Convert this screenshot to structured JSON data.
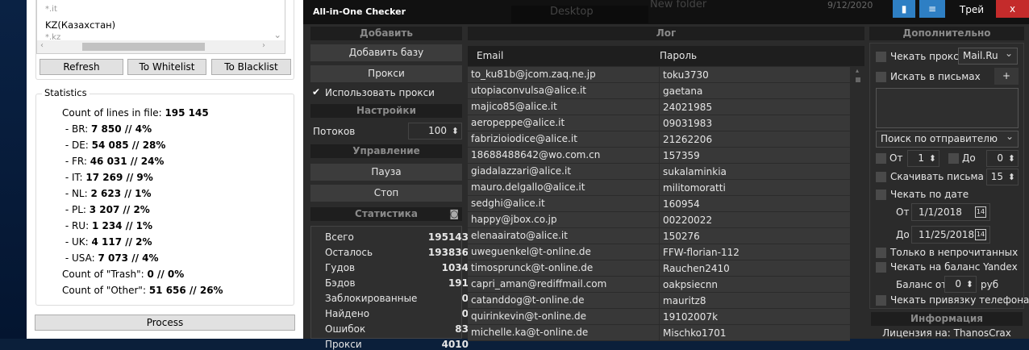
{
  "left_window": {
    "list_items": [
      "*.it",
      "KZ(Казахстан)",
      "*.kz"
    ],
    "buttons": {
      "refresh": "Refresh",
      "whitelist": "To Whitelist",
      "blacklist": "To Blacklist"
    },
    "statistics": {
      "title": "Statistics",
      "lines": [
        {
          "label": "Count of lines in file: ",
          "value": "195 145"
        },
        {
          "label": " - BR: ",
          "value": "7 850 // 4%"
        },
        {
          "label": " - DE: ",
          "value": "54 085 // 28%"
        },
        {
          "label": " - FR: ",
          "value": "46 031 // 24%"
        },
        {
          "label": " - IT: ",
          "value": "17 269 // 9%"
        },
        {
          "label": " - NL: ",
          "value": "2 623 // 1%"
        },
        {
          "label": " - PL: ",
          "value": "3 207 // 2%"
        },
        {
          "label": " - RU: ",
          "value": "1 234 // 1%"
        },
        {
          "label": " - UK: ",
          "value": "4 117 // 2%"
        },
        {
          "label": " - USA: ",
          "value": "7 073 // 4%"
        },
        {
          "label": "Count of \"Trash\": ",
          "value": "0 // 0%"
        },
        {
          "label": "Count of \"Other\": ",
          "value": "51 656 // 26%"
        }
      ]
    },
    "process": "Process"
  },
  "background": {
    "desktop": "Desktop",
    "folder": "New folder",
    "date": "9/12/2020"
  },
  "app": {
    "title": "All-in-One Checker",
    "tray": "Трей",
    "close": "x",
    "left": {
      "add_header": "Добавить",
      "add_base": "Добавить базу",
      "proxy": "Прокси",
      "use_proxy": "Использовать прокси",
      "use_proxy_checked": true,
      "settings_header": "Настройки",
      "threads_label": "Потоков",
      "threads": "100",
      "control_header": "Управление",
      "pause": "Пауза",
      "stop": "Стоп",
      "stats_header": "Статистика",
      "stats": [
        {
          "label": "Всего",
          "value": "195143"
        },
        {
          "label": "Осталось",
          "value": "193836"
        },
        {
          "label": "Гудов",
          "value": "1034"
        },
        {
          "label": "Бэдов",
          "value": "191"
        },
        {
          "label": "Заблокированные",
          "value": "0"
        },
        {
          "label": "Найдено",
          "value": "0"
        },
        {
          "label": "Ошибок",
          "value": "83"
        },
        {
          "label": "Прокси",
          "value": "4010"
        }
      ]
    },
    "log": {
      "header": "Лог",
      "columns": [
        "Email",
        "Пароль"
      ],
      "rows": [
        [
          "to_ku81b@jcom.zaq.ne.jp",
          "toku3730"
        ],
        [
          "utopiaconvulsa@alice.it",
          "gaetana"
        ],
        [
          "majico85@alice.it",
          "24021985"
        ],
        [
          "aeropeppe@alice.it",
          "09031983"
        ],
        [
          "fabrizioiodice@alice.it",
          "21262206"
        ],
        [
          "18688488642@wo.com.cn",
          "157359"
        ],
        [
          "giadalazzari@alice.it",
          "sukalaminkia"
        ],
        [
          "mauro.delgallo@alice.it",
          "militomoratti"
        ],
        [
          "sedghi@alice.it",
          "160954"
        ],
        [
          "happy@jbox.co.jp",
          "00220022"
        ],
        [
          "elenaairato@alice.it",
          "150276"
        ],
        [
          "uweguenkel@t-online.de",
          "FFW-florian-112"
        ],
        [
          "timosprunck@t-online.de",
          "Rauchen2410"
        ],
        [
          "capri_aman@rediffmail.com",
          "oakpsiecnn"
        ],
        [
          "catanddog@t-online.de",
          "mauritz8"
        ],
        [
          "quirinkevin@t-online.de",
          "19102007k"
        ],
        [
          "michelle.ka@t-online.de",
          "Mischko1701"
        ]
      ]
    },
    "right": {
      "header": "Дополнительно",
      "check_proxy": "Чекать прокси",
      "proxy_service": "Mail.Ru",
      "search_mail": "Искать в письмах",
      "plus": "+",
      "search_mode": "Поиск по отправителю",
      "from_label": "От",
      "from_val": "1",
      "to_label": "До",
      "to_val": "0",
      "download": "Скачивать письма",
      "download_val": "15",
      "by_date": "Чекать по дате",
      "date_from_label": "От",
      "date_from": "1/1/2018",
      "date_to_label": "До",
      "date_to": "11/25/2018",
      "calendar_day": "14",
      "unread": "Только в непрочитанных",
      "yandex": "Чекать на баланс Yandex",
      "balance_label": "Баланс от",
      "balance": "0",
      "currency": "руб",
      "phone": "Чекать привязку телефона",
      "info_header": "Информация",
      "license": "Лицензия на: ThanosCrax"
    }
  }
}
